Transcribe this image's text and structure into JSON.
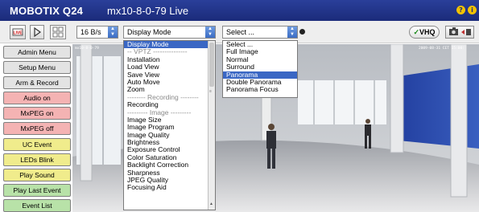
{
  "header": {
    "app_title": "MOBOTIX Q24",
    "camera_name": "mx10-8-0-79 Live",
    "help_icon": "?",
    "info_icon": "i"
  },
  "toolbar": {
    "live_icon": "live-icon",
    "play_icon": "play-icon",
    "multiview_icon": "grid-icon",
    "rate_value": "16 B/s",
    "display_mode_value": "Display Mode",
    "select_value": "Select ...",
    "vhq_label": "VHQ",
    "camera_icon": "camera-icon"
  },
  "sidebar": {
    "buttons": [
      {
        "label": "Admin Menu",
        "color": "#e3e3e3"
      },
      {
        "label": "Setup Menu",
        "color": "#e3e3e3"
      },
      {
        "label": "Arm & Record",
        "color": "#e3e3e3"
      },
      {
        "label": "Audio on",
        "color": "#f4b3b3"
      },
      {
        "label": "MxPEG on",
        "color": "#f4b3b3"
      },
      {
        "label": "MxPEG off",
        "color": "#f4b3b3"
      },
      {
        "label": "UC Event",
        "color": "#f0ec8c"
      },
      {
        "label": "LEDs Blink",
        "color": "#f0ec8c"
      },
      {
        "label": "Play Sound",
        "color": "#f0ec8c"
      },
      {
        "label": "Play Last Event",
        "color": "#b8e2a8"
      },
      {
        "label": "Event List",
        "color": "#b8e2a8"
      }
    ]
  },
  "display_mode_menu": {
    "items": [
      {
        "label": "Display Mode",
        "state": "selected"
      },
      {
        "label": "-- VPTZ ---------------",
        "state": "separator"
      },
      {
        "label": "Installation",
        "state": "normal"
      },
      {
        "label": "Load View",
        "state": "normal"
      },
      {
        "label": "Save View",
        "state": "normal"
      },
      {
        "label": "Auto Move",
        "state": "normal"
      },
      {
        "label": "Zoom",
        "state": "normal"
      },
      {
        "label": "-------- Recording --------",
        "state": "separator"
      },
      {
        "label": "Recording",
        "state": "normal"
      },
      {
        "label": "--------- Image ---------",
        "state": "separator"
      },
      {
        "label": "Image Size",
        "state": "normal"
      },
      {
        "label": "Image Program",
        "state": "normal"
      },
      {
        "label": "Image Quality",
        "state": "normal"
      },
      {
        "label": "Brightness",
        "state": "normal"
      },
      {
        "label": "Exposure Control",
        "state": "normal"
      },
      {
        "label": "Color Saturation",
        "state": "normal"
      },
      {
        "label": "Backlight Correction",
        "state": "normal"
      },
      {
        "label": "Sharpness",
        "state": "normal"
      },
      {
        "label": "JPEG Quality",
        "state": "normal"
      },
      {
        "label": "Focusing Aid",
        "state": "normal"
      }
    ]
  },
  "select_menu": {
    "items": [
      {
        "label": "Select ...",
        "state": "normal"
      },
      {
        "label": "Full Image",
        "state": "normal"
      },
      {
        "label": "Normal",
        "state": "normal"
      },
      {
        "label": "Surround",
        "state": "normal"
      },
      {
        "label": "Panorama",
        "state": "selected"
      },
      {
        "label": "Double Panorama",
        "state": "normal"
      },
      {
        "label": "Panorama Focus",
        "state": "normal"
      }
    ]
  },
  "video": {
    "timestamp_left": "mx10-8-0-79",
    "timestamp_right": "2009-08-31 CET 15:00:"
  },
  "colors": {
    "title_bar": "#1b2b7a",
    "selection": "#3a67c4",
    "pink_button": "#f4b3b3",
    "yellow_button": "#f0ec8c",
    "green_button": "#b8e2a8"
  }
}
